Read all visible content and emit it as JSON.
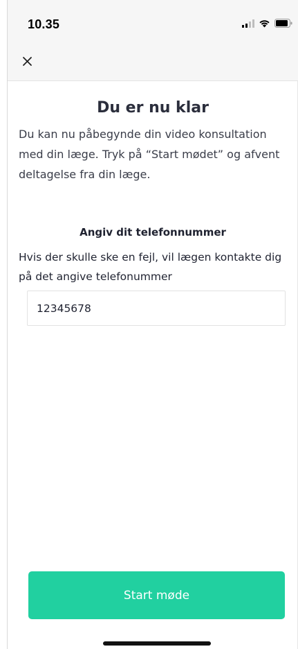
{
  "status_bar": {
    "time": "10.35",
    "icons": [
      "signal-icon",
      "wifi-icon",
      "battery-icon"
    ]
  },
  "nav": {
    "close_icon": "close-icon"
  },
  "content": {
    "title": "Du er nu klar",
    "intro": "Du kan nu påbegynde din video konsultation med din læge. Tryk på “Start mødet” og afvent deltagelse fra din læge.",
    "phone_heading": "Angiv dit telefonnummer",
    "phone_description": "Hvis der skulle ske en fejl, vil lægen kontakte dig på det angive telefonummer",
    "phone_value": "12345678"
  },
  "actions": {
    "start_label": "Start møde"
  },
  "colors": {
    "accent": "#21d0a0",
    "header_bg": "#f6f6f6"
  }
}
